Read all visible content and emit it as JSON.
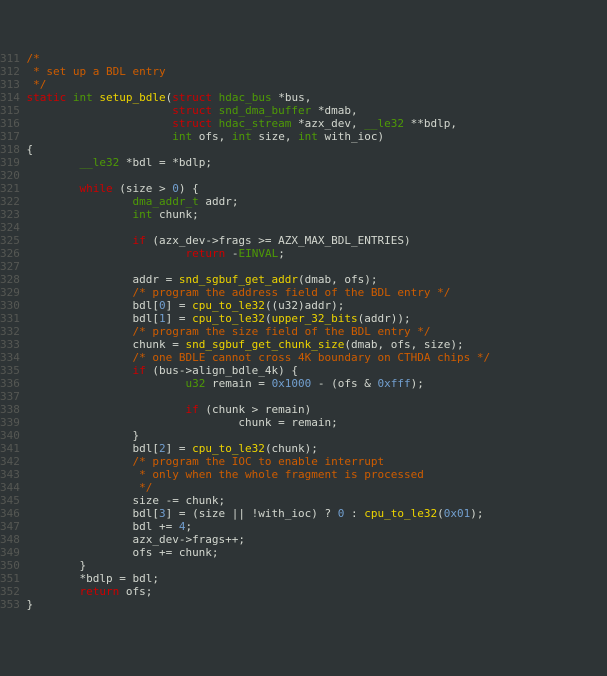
{
  "lines": [
    {
      "num": "311",
      "frags": [
        {
          "c": "cmt",
          "t": "/*"
        }
      ]
    },
    {
      "num": "312",
      "frags": [
        {
          "c": "cmt",
          "t": " * set up a BDL entry"
        }
      ]
    },
    {
      "num": "313",
      "frags": [
        {
          "c": "cmt",
          "t": " */"
        }
      ]
    },
    {
      "num": "314",
      "frags": [
        {
          "c": "kw",
          "t": "static"
        },
        {
          "c": "id",
          "t": " "
        },
        {
          "c": "ty",
          "t": "int"
        },
        {
          "c": "id",
          "t": " "
        },
        {
          "c": "fn",
          "t": "setup_bdle"
        },
        {
          "c": "id",
          "t": "("
        },
        {
          "c": "kw",
          "t": "struct"
        },
        {
          "c": "id",
          "t": " "
        },
        {
          "c": "ty",
          "t": "hdac_bus"
        },
        {
          "c": "id",
          "t": " *bus,"
        }
      ]
    },
    {
      "num": "315",
      "frags": [
        {
          "c": "id",
          "t": "                      "
        },
        {
          "c": "kw",
          "t": "struct"
        },
        {
          "c": "id",
          "t": " "
        },
        {
          "c": "ty",
          "t": "snd_dma_buffer"
        },
        {
          "c": "id",
          "t": " *dmab,"
        }
      ]
    },
    {
      "num": "316",
      "frags": [
        {
          "c": "id",
          "t": "                      "
        },
        {
          "c": "kw",
          "t": "struct"
        },
        {
          "c": "id",
          "t": " "
        },
        {
          "c": "ty",
          "t": "hdac_stream"
        },
        {
          "c": "id",
          "t": " *azx_dev, "
        },
        {
          "c": "ty",
          "t": "__le32"
        },
        {
          "c": "id",
          "t": " **bdlp,"
        }
      ]
    },
    {
      "num": "317",
      "frags": [
        {
          "c": "id",
          "t": "                      "
        },
        {
          "c": "ty",
          "t": "int"
        },
        {
          "c": "id",
          "t": " ofs, "
        },
        {
          "c": "ty",
          "t": "int"
        },
        {
          "c": "id",
          "t": " size, "
        },
        {
          "c": "ty",
          "t": "int"
        },
        {
          "c": "id",
          "t": " with_ioc)"
        }
      ]
    },
    {
      "num": "318",
      "frags": [
        {
          "c": "id",
          "t": "{"
        }
      ]
    },
    {
      "num": "319",
      "frags": [
        {
          "c": "id",
          "t": "        "
        },
        {
          "c": "ty",
          "t": "__le32"
        },
        {
          "c": "id",
          "t": " *bdl = *bdlp;"
        }
      ]
    },
    {
      "num": "320",
      "frags": [
        {
          "c": "id",
          "t": ""
        }
      ]
    },
    {
      "num": "321",
      "frags": [
        {
          "c": "id",
          "t": "        "
        },
        {
          "c": "kw",
          "t": "while"
        },
        {
          "c": "id",
          "t": " (size > "
        },
        {
          "c": "num",
          "t": "0"
        },
        {
          "c": "id",
          "t": ") {"
        }
      ]
    },
    {
      "num": "322",
      "frags": [
        {
          "c": "id",
          "t": "                "
        },
        {
          "c": "ty",
          "t": "dma_addr_t"
        },
        {
          "c": "id",
          "t": " addr;"
        }
      ]
    },
    {
      "num": "323",
      "frags": [
        {
          "c": "id",
          "t": "                "
        },
        {
          "c": "ty",
          "t": "int"
        },
        {
          "c": "id",
          "t": " chunk;"
        }
      ]
    },
    {
      "num": "324",
      "frags": [
        {
          "c": "id",
          "t": ""
        }
      ]
    },
    {
      "num": "325",
      "frags": [
        {
          "c": "id",
          "t": "                "
        },
        {
          "c": "kw",
          "t": "if"
        },
        {
          "c": "id",
          "t": " (azx_dev->frags >= AZX_MAX_BDL_ENTRIES)"
        }
      ]
    },
    {
      "num": "326",
      "frags": [
        {
          "c": "id",
          "t": "                        "
        },
        {
          "c": "kw",
          "t": "return"
        },
        {
          "c": "id",
          "t": " -"
        },
        {
          "c": "ty",
          "t": "EINVAL"
        },
        {
          "c": "id",
          "t": ";"
        }
      ]
    },
    {
      "num": "327",
      "frags": [
        {
          "c": "id",
          "t": ""
        }
      ]
    },
    {
      "num": "328",
      "frags": [
        {
          "c": "id",
          "t": "                addr = "
        },
        {
          "c": "fn",
          "t": "snd_sgbuf_get_addr"
        },
        {
          "c": "id",
          "t": "(dmab, ofs);"
        }
      ]
    },
    {
      "num": "329",
      "frags": [
        {
          "c": "id",
          "t": "                "
        },
        {
          "c": "cmt",
          "t": "/* program the address field of the BDL entry */"
        }
      ]
    },
    {
      "num": "330",
      "frags": [
        {
          "c": "id",
          "t": "                bdl["
        },
        {
          "c": "num",
          "t": "0"
        },
        {
          "c": "id",
          "t": "] = "
        },
        {
          "c": "fn",
          "t": "cpu_to_le32"
        },
        {
          "c": "id",
          "t": "((u32)addr);"
        }
      ]
    },
    {
      "num": "331",
      "frags": [
        {
          "c": "id",
          "t": "                bdl["
        },
        {
          "c": "num",
          "t": "1"
        },
        {
          "c": "id",
          "t": "] = "
        },
        {
          "c": "fn",
          "t": "cpu_to_le32"
        },
        {
          "c": "id",
          "t": "("
        },
        {
          "c": "fn",
          "t": "upper_32_bits"
        },
        {
          "c": "id",
          "t": "(addr));"
        }
      ]
    },
    {
      "num": "332",
      "frags": [
        {
          "c": "id",
          "t": "                "
        },
        {
          "c": "cmt",
          "t": "/* program the size field of the BDL entry */"
        }
      ]
    },
    {
      "num": "333",
      "frags": [
        {
          "c": "id",
          "t": "                chunk = "
        },
        {
          "c": "fn",
          "t": "snd_sgbuf_get_chunk_size"
        },
        {
          "c": "id",
          "t": "(dmab, ofs, size);"
        }
      ]
    },
    {
      "num": "334",
      "frags": [
        {
          "c": "id",
          "t": "                "
        },
        {
          "c": "cmt",
          "t": "/* one BDLE cannot cross 4K boundary on CTHDA chips */"
        }
      ]
    },
    {
      "num": "335",
      "frags": [
        {
          "c": "id",
          "t": "                "
        },
        {
          "c": "kw",
          "t": "if"
        },
        {
          "c": "id",
          "t": " (bus->align_bdle_4k) {"
        }
      ]
    },
    {
      "num": "336",
      "frags": [
        {
          "c": "id",
          "t": "                        "
        },
        {
          "c": "ty",
          "t": "u32"
        },
        {
          "c": "id",
          "t": " remain = "
        },
        {
          "c": "num",
          "t": "0x1000"
        },
        {
          "c": "id",
          "t": " - (ofs & "
        },
        {
          "c": "num",
          "t": "0xfff"
        },
        {
          "c": "id",
          "t": ");"
        }
      ]
    },
    {
      "num": "337",
      "frags": [
        {
          "c": "id",
          "t": ""
        }
      ]
    },
    {
      "num": "338",
      "frags": [
        {
          "c": "id",
          "t": "                        "
        },
        {
          "c": "kw",
          "t": "if"
        },
        {
          "c": "id",
          "t": " (chunk > remain)"
        }
      ]
    },
    {
      "num": "339",
      "frags": [
        {
          "c": "id",
          "t": "                                chunk = remain;"
        }
      ]
    },
    {
      "num": "340",
      "frags": [
        {
          "c": "id",
          "t": "                }"
        }
      ]
    },
    {
      "num": "341",
      "frags": [
        {
          "c": "id",
          "t": "                bdl["
        },
        {
          "c": "num",
          "t": "2"
        },
        {
          "c": "id",
          "t": "] = "
        },
        {
          "c": "fn",
          "t": "cpu_to_le32"
        },
        {
          "c": "id",
          "t": "(chunk);"
        }
      ]
    },
    {
      "num": "342",
      "frags": [
        {
          "c": "id",
          "t": "                "
        },
        {
          "c": "cmt",
          "t": "/* program the IOC to enable interrupt"
        }
      ]
    },
    {
      "num": "343",
      "frags": [
        {
          "c": "id",
          "t": "                "
        },
        {
          "c": "cmt",
          "t": " * only when the whole fragment is processed"
        }
      ]
    },
    {
      "num": "344",
      "frags": [
        {
          "c": "id",
          "t": "                "
        },
        {
          "c": "cmt",
          "t": " */"
        }
      ]
    },
    {
      "num": "345",
      "frags": [
        {
          "c": "id",
          "t": "                size -= chunk;"
        }
      ]
    },
    {
      "num": "346",
      "frags": [
        {
          "c": "id",
          "t": "                bdl["
        },
        {
          "c": "num",
          "t": "3"
        },
        {
          "c": "id",
          "t": "] = (size || !with_ioc) ? "
        },
        {
          "c": "num",
          "t": "0"
        },
        {
          "c": "id",
          "t": " : "
        },
        {
          "c": "fn",
          "t": "cpu_to_le32"
        },
        {
          "c": "id",
          "t": "("
        },
        {
          "c": "num",
          "t": "0x01"
        },
        {
          "c": "id",
          "t": ");"
        }
      ]
    },
    {
      "num": "347",
      "frags": [
        {
          "c": "id",
          "t": "                bdl += "
        },
        {
          "c": "num",
          "t": "4"
        },
        {
          "c": "id",
          "t": ";"
        }
      ]
    },
    {
      "num": "348",
      "frags": [
        {
          "c": "id",
          "t": "                azx_dev->frags++;"
        }
      ]
    },
    {
      "num": "349",
      "frags": [
        {
          "c": "id",
          "t": "                ofs += chunk;"
        }
      ]
    },
    {
      "num": "350",
      "frags": [
        {
          "c": "id",
          "t": "        }"
        }
      ]
    },
    {
      "num": "351",
      "frags": [
        {
          "c": "id",
          "t": "        *bdlp = bdl;"
        }
      ]
    },
    {
      "num": "352",
      "frags": [
        {
          "c": "id",
          "t": "        "
        },
        {
          "c": "kw",
          "t": "return"
        },
        {
          "c": "id",
          "t": " ofs;"
        }
      ]
    },
    {
      "num": "353",
      "frags": [
        {
          "c": "id",
          "t": "}"
        }
      ]
    }
  ]
}
